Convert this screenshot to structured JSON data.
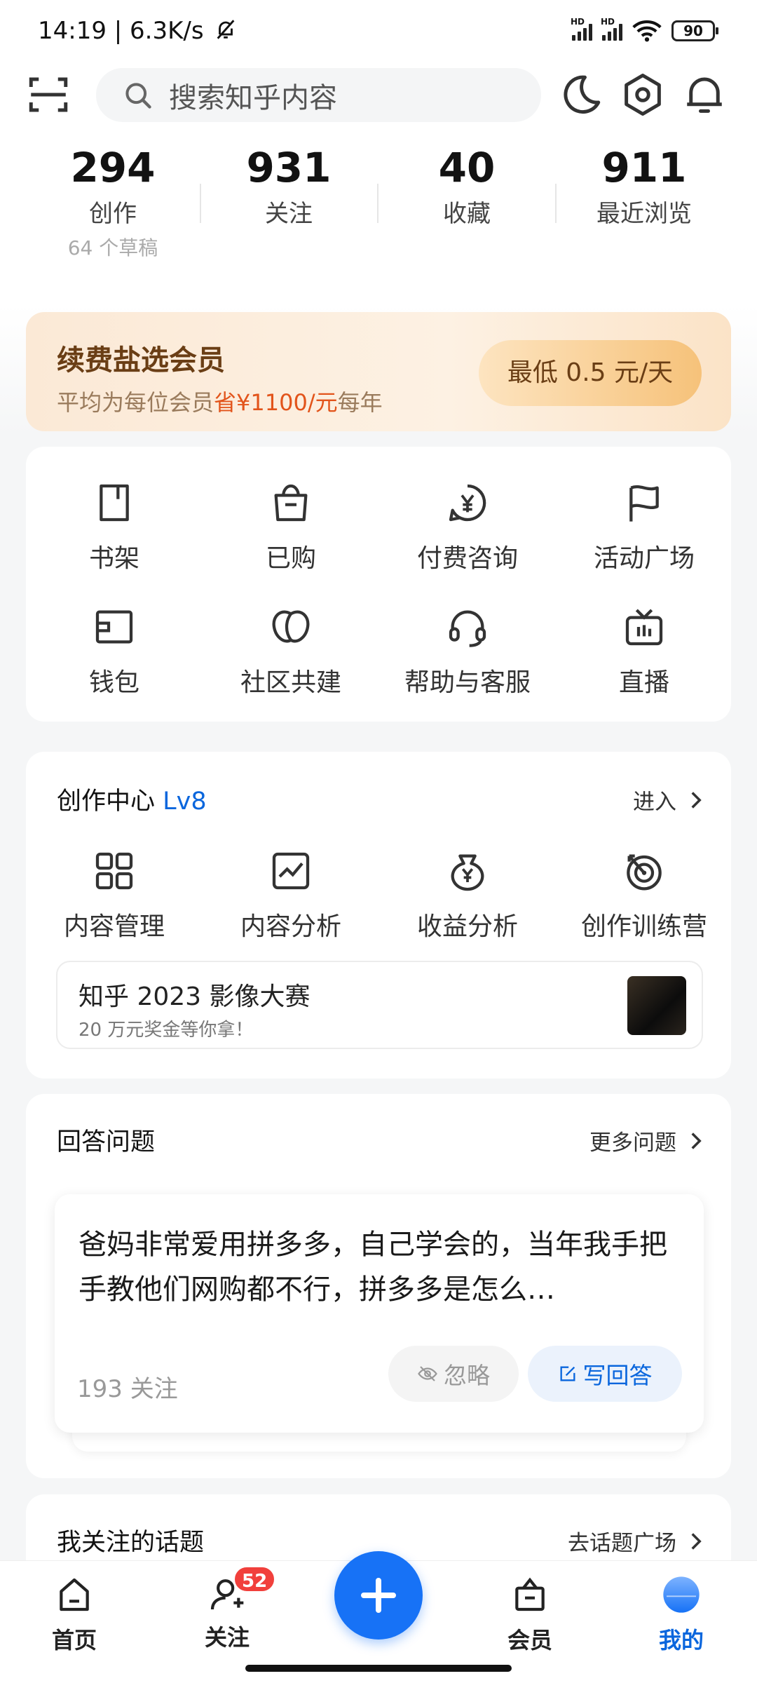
{
  "status_bar": {
    "time": "14:19 | 6.3K/s",
    "battery": "90",
    "network_tag": "HD"
  },
  "header": {
    "search_placeholder": "搜索知乎内容"
  },
  "stats": [
    {
      "value": "294",
      "label": "创作",
      "sub": "64 个草稿"
    },
    {
      "value": "931",
      "label": "关注"
    },
    {
      "value": "40",
      "label": "收藏"
    },
    {
      "value": "911",
      "label": "最近浏览"
    }
  ],
  "vip_banner": {
    "title": "续费盐选会员",
    "subtitle_prefix": "平均为每位会员",
    "subtitle_highlight": "省¥1100/元",
    "subtitle_suffix": "每年",
    "button": "最低 0.5 元/天"
  },
  "tools": [
    {
      "label": "书架",
      "icon": "bookshelf-icon"
    },
    {
      "label": "已购",
      "icon": "purchased-bag-icon"
    },
    {
      "label": "付费咨询",
      "icon": "paid-consult-icon"
    },
    {
      "label": "活动广场",
      "icon": "flag-icon"
    },
    {
      "label": "钱包",
      "icon": "wallet-icon"
    },
    {
      "label": "社区共建",
      "icon": "community-icon"
    },
    {
      "label": "帮助与客服",
      "icon": "headset-icon"
    },
    {
      "label": "直播",
      "icon": "live-tv-icon"
    }
  ],
  "creation_center": {
    "title": "创作中心",
    "level": "Lv8",
    "enter": "进入",
    "items": [
      {
        "label": "内容管理",
        "icon": "grid-icon"
      },
      {
        "label": "内容分析",
        "icon": "chart-icon"
      },
      {
        "label": "收益分析",
        "icon": "money-bag-icon"
      },
      {
        "label": "创作训练营",
        "icon": "target-icon"
      }
    ],
    "contest": {
      "title": "知乎 2023 影像大赛",
      "subtitle": "20 万元奖金等你拿！"
    }
  },
  "answer_section": {
    "title": "回答问题",
    "more": "更多问题",
    "question": "爸妈非常爱用拼多多，自己学会的，当年我手把手教他们网购都不行，拼多多是怎么…",
    "followers": "193 关注",
    "ignore": "忽略",
    "write": "写回答"
  },
  "topics_section": {
    "title": "我关注的话题",
    "link": "去话题广场"
  },
  "bottom_nav": {
    "home": "首页",
    "follow": "关注",
    "follow_badge": "52",
    "vip": "会员",
    "me": "我的"
  },
  "colors": {
    "accent": "#0a66dd",
    "fab": "#1772f6",
    "badge": "#f1403c",
    "vip_text": "#6a3e15"
  }
}
